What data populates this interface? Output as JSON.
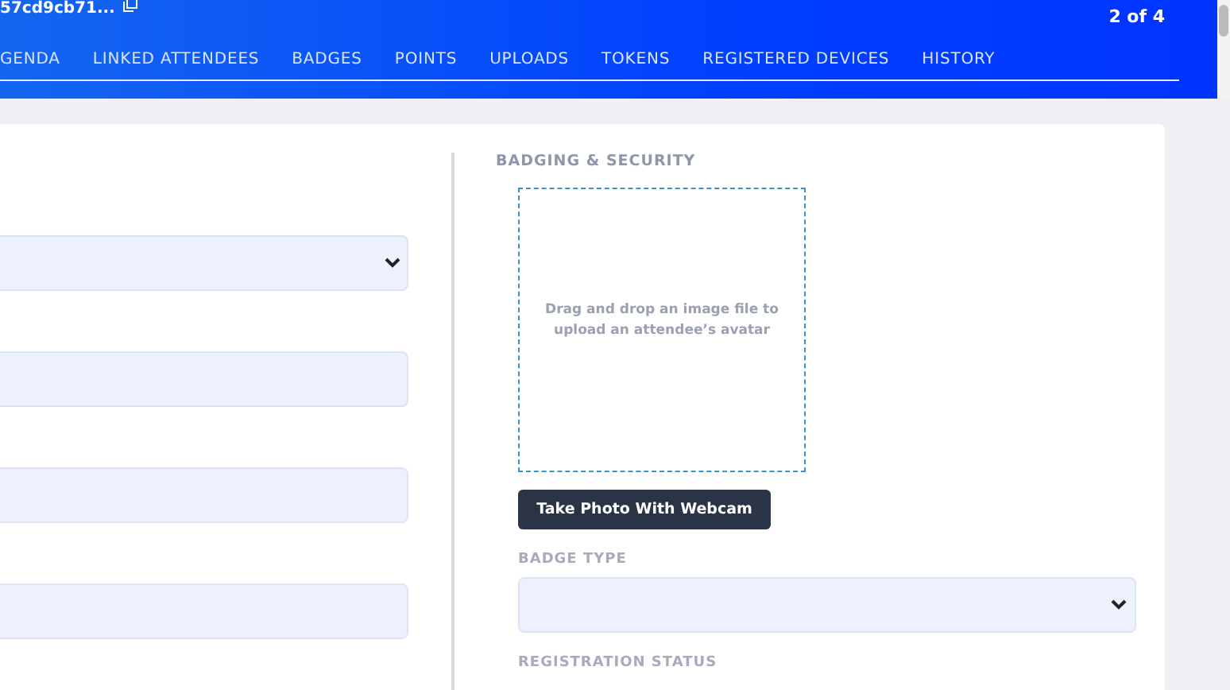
{
  "header": {
    "title": "57cd9cb71...",
    "pager": "2 of 4",
    "tabs": [
      {
        "label": "GENDA"
      },
      {
        "label": "LINKED ATTENDEES"
      },
      {
        "label": "BADGES"
      },
      {
        "label": "POINTS"
      },
      {
        "label": "UPLOADS"
      },
      {
        "label": "TOKENS"
      },
      {
        "label": "REGISTERED DEVICES"
      },
      {
        "label": "HISTORY"
      }
    ]
  },
  "left_fields": [
    {
      "kind": "select"
    },
    {
      "kind": "input"
    },
    {
      "kind": "input"
    },
    {
      "kind": "input"
    }
  ],
  "badging": {
    "heading": "BADGING & SECURITY",
    "dropzone_text": "Drag and drop an image file to upload an attendee’s avatar",
    "webcam_button": "Take Photo With Webcam",
    "fields": [
      {
        "label": "BADGE TYPE",
        "kind": "select"
      },
      {
        "label": "REGISTRATION STATUS",
        "kind": "label"
      }
    ]
  }
}
